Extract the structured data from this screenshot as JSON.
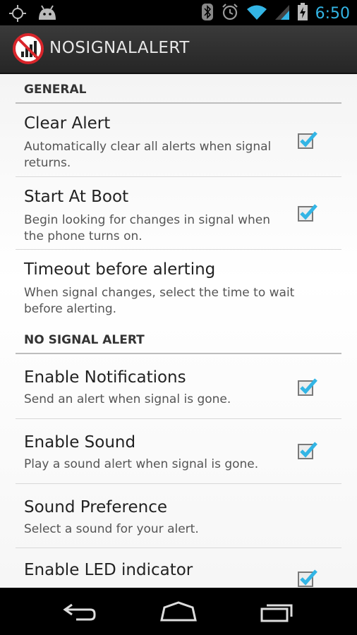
{
  "status_bar": {
    "time": "6:50",
    "icons": [
      "gps-icon",
      "android-icon",
      "bluetooth-icon",
      "alarm-icon",
      "wifi-icon",
      "signal-icon",
      "battery-charging-icon"
    ]
  },
  "action_bar": {
    "title_part1": "NO",
    "title_part2": "SIGNAL",
    "title_part3": "ALERT",
    "logo_icon": "no-signal-logo-icon"
  },
  "sections": [
    {
      "header": "GENERAL",
      "items": [
        {
          "title": "Clear Alert",
          "summary": "Automatically clear all alerts when signal returns.",
          "checked": true
        },
        {
          "title": "Start At Boot",
          "summary": "Begin looking for changes in signal when the phone turns on.",
          "checked": true
        },
        {
          "title": "Timeout before alerting",
          "summary": "When signal changes, select the time to wait before alerting.",
          "checked": null
        }
      ]
    },
    {
      "header": "NO SIGNAL ALERT",
      "items": [
        {
          "title": "Enable Notifications",
          "summary": "Send an alert when signal is gone.",
          "checked": true
        },
        {
          "title": "Enable Sound",
          "summary": "Play a sound alert when signal is gone.",
          "checked": true
        },
        {
          "title": "Sound Preference",
          "summary": "Select a sound for your alert.",
          "checked": null
        },
        {
          "title": "Enable LED indicator",
          "summary": "",
          "checked": true
        }
      ]
    }
  ],
  "nav_bar": {
    "buttons": [
      "back-icon",
      "home-icon",
      "recent-apps-icon"
    ]
  },
  "colors": {
    "accent": "#33b5e5",
    "check": "#33b5e5"
  }
}
